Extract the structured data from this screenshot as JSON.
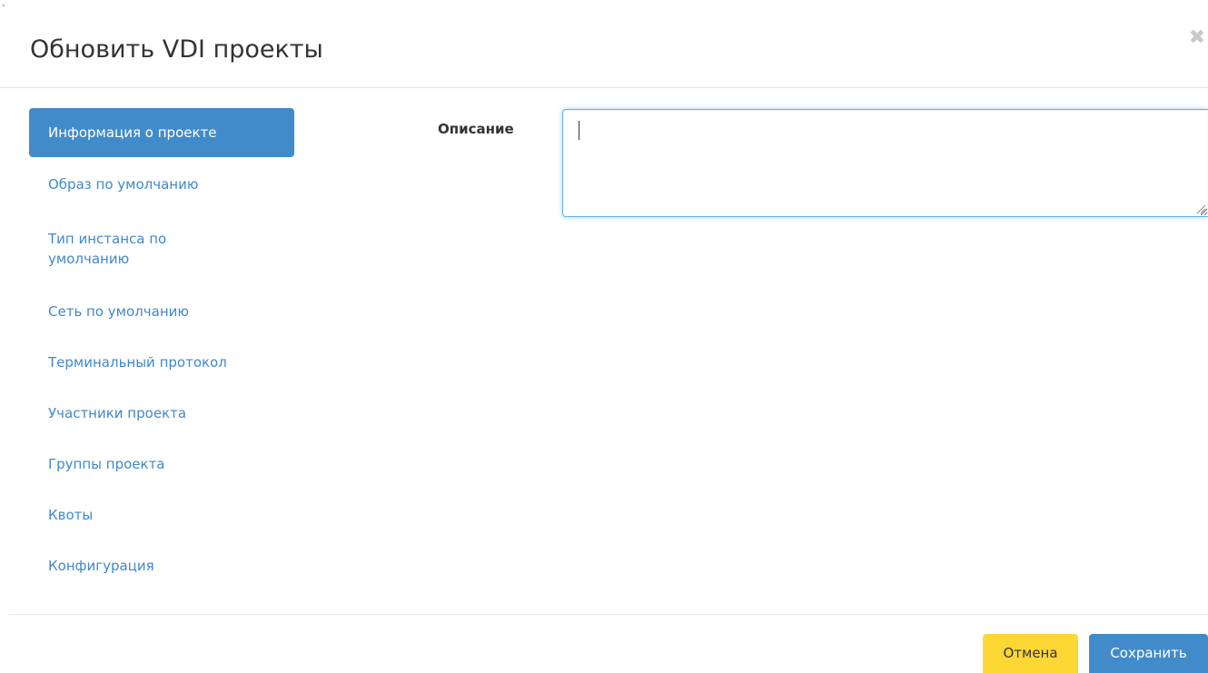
{
  "modal": {
    "title": "Обновить VDI проекты",
    "close_icon": "close-icon"
  },
  "nav": {
    "items": [
      {
        "label": "Информация о проекте",
        "active": true
      },
      {
        "label": "Образ по умолчанию",
        "active": false
      },
      {
        "label": "Тип инстанса по умолчанию",
        "active": false
      },
      {
        "label": "Сеть по умолчанию",
        "active": false
      },
      {
        "label": "Терминальный протокол",
        "active": false
      },
      {
        "label": "Участники проекта",
        "active": false
      },
      {
        "label": "Группы проекта",
        "active": false
      },
      {
        "label": "Квоты",
        "active": false
      },
      {
        "label": "Конфигурация",
        "active": false
      }
    ]
  },
  "form": {
    "description_label": "Описание",
    "description_value": ""
  },
  "footer": {
    "cancel_label": "Отмена",
    "save_label": "Сохранить"
  },
  "colors": {
    "primary": "#428bca",
    "link": "#3f88cd",
    "cancel": "#fdd835",
    "focus_border": "#66afe9"
  }
}
